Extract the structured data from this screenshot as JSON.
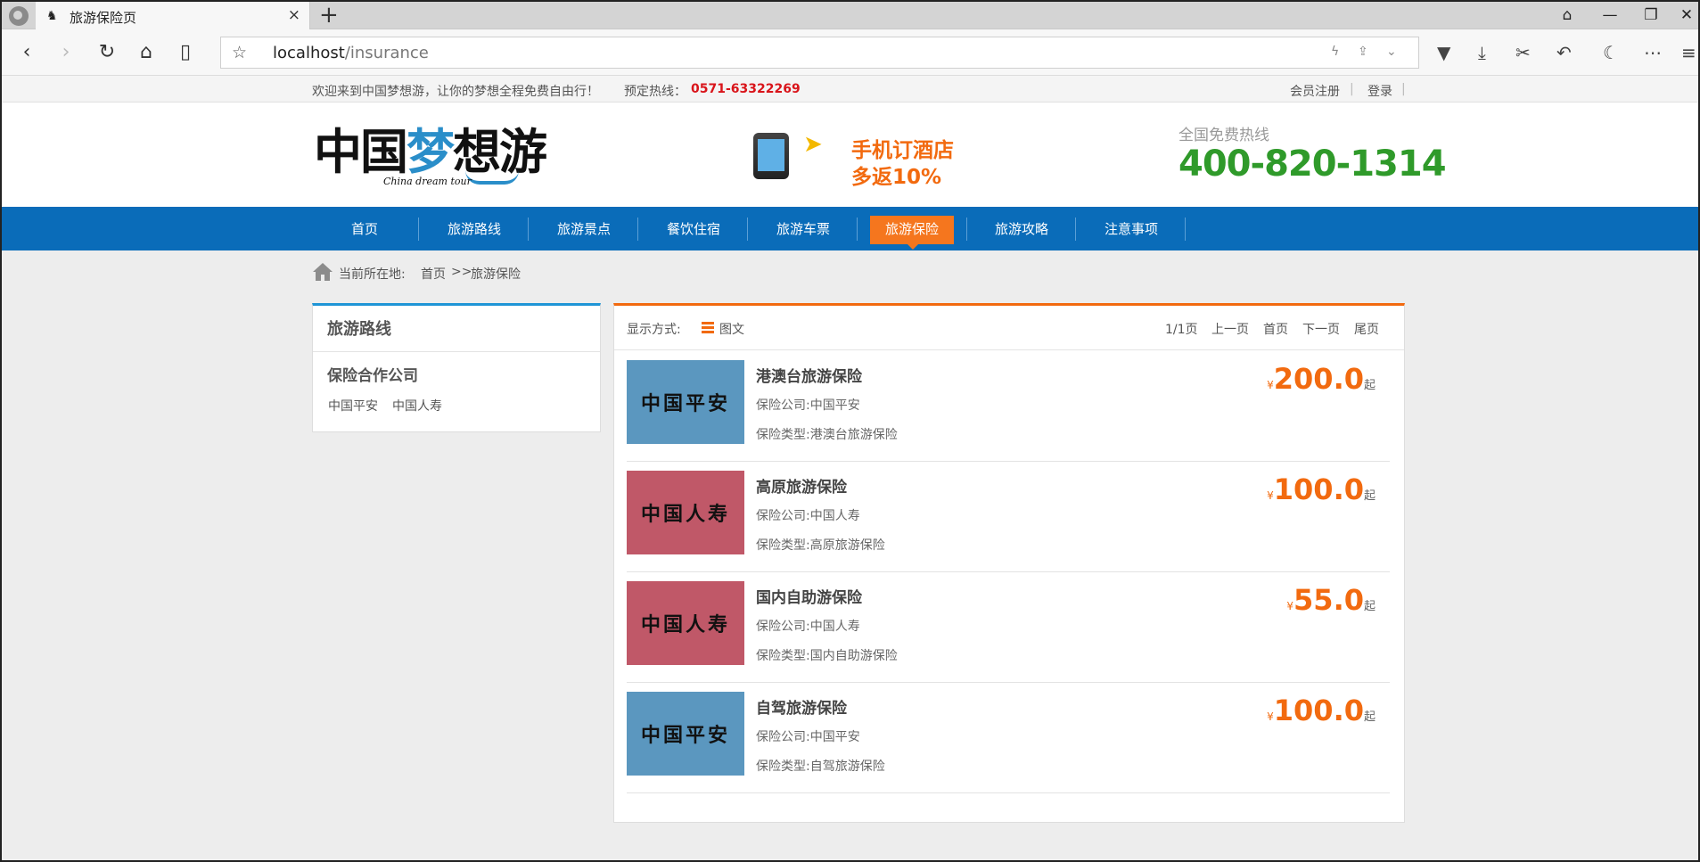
{
  "browser": {
    "tab_title": "旅游保险页",
    "tab_close": "×",
    "new_tab": "+",
    "url_host": "localhost",
    "url_path": "/insurance"
  },
  "topbar": {
    "welcome": "欢迎来到中国梦想游，让你的梦想全程免费自由行！",
    "hotline_label": "预定热线：",
    "hotline": "0571-63322269",
    "register": "会员注册",
    "login": "登录",
    "sep": "|"
  },
  "header": {
    "logo_text_a": "中国",
    "logo_text_b": "梦",
    "logo_text_c": "想游",
    "logo_sub": "China dream tour",
    "promo_line1": "手机订酒店",
    "promo_line2": "多返10%",
    "hotline_label": "全国免费热线",
    "hotline_number": "400-820-1314"
  },
  "nav": {
    "items": [
      {
        "label": "首页"
      },
      {
        "label": "旅游路线"
      },
      {
        "label": "旅游景点"
      },
      {
        "label": "餐饮住宿"
      },
      {
        "label": "旅游车票"
      },
      {
        "label": "旅游保险"
      },
      {
        "label": "旅游攻略"
      },
      {
        "label": "注意事项"
      }
    ],
    "active": "旅游保险"
  },
  "breadcrumb": {
    "label": "当前所在地:",
    "home": "首页",
    "arrow": ">>",
    "current": "旅游保险"
  },
  "sidebar": {
    "title": "旅游路线",
    "subtitle": "保险合作公司",
    "links": [
      "中国平安",
      "中国人寿"
    ]
  },
  "list": {
    "display_label": "显示方式:",
    "display_mode": "图文",
    "page_info": "1/1页",
    "prev": "上一页",
    "first": "首页",
    "next": "下一页",
    "last": "尾页",
    "company_label": "保险公司:",
    "type_label": "保险类型:",
    "currency": "¥",
    "price_suffix": "起",
    "items": [
      {
        "thumb_text": "中国平安",
        "thumb_color": "#5b97bf",
        "title": "港澳台旅游保险",
        "company": "中国平安",
        "type": "港澳台旅游保险",
        "price": "200.0"
      },
      {
        "thumb_text": "中国人寿",
        "thumb_color": "#c05868",
        "title": "高原旅游保险",
        "company": "中国人寿",
        "type": "高原旅游保险",
        "price": "100.0"
      },
      {
        "thumb_text": "中国人寿",
        "thumb_color": "#c05868",
        "title": "国内自助游保险",
        "company": "中国人寿",
        "type": "国内自助游保险",
        "price": "55.0"
      },
      {
        "thumb_text": "中国平安",
        "thumb_color": "#5b97bf",
        "title": "自驾旅游保险",
        "company": "中国平安",
        "type": "自驾旅游保险",
        "price": "100.0"
      }
    ]
  },
  "colors": {
    "nav_blue": "#0a6cb9",
    "accent_orange": "#f26a0f",
    "hotline_green": "#2f9a2a",
    "hotline_red": "#d9141a"
  }
}
